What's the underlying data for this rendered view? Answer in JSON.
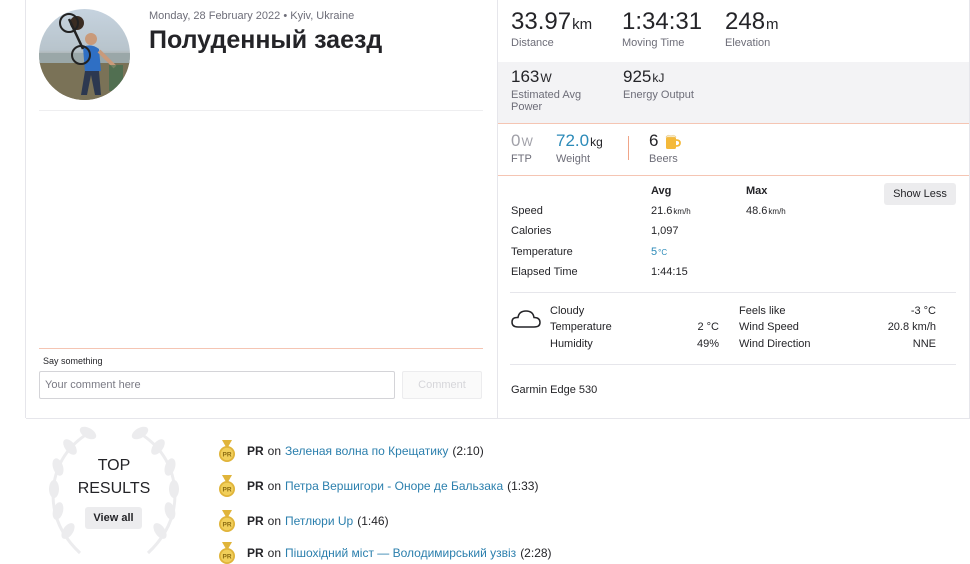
{
  "activity": {
    "meta": "Monday, 28 February 2022 • Kyiv, Ukraine",
    "title": "Полуденный заезд"
  },
  "comment": {
    "label": "Say something",
    "placeholder": "Your comment here",
    "button": "Comment"
  },
  "stats": {
    "distance": {
      "value": "33.97",
      "unit": "km",
      "label": "Distance"
    },
    "moving_time": {
      "value": "1:34:31",
      "label": "Moving Time"
    },
    "elevation": {
      "value": "248",
      "unit": "m",
      "label": "Elevation"
    },
    "power": {
      "value": "163",
      "unit": "W",
      "label_line1": "Estimated Avg",
      "label_line2": "Power"
    },
    "energy": {
      "value": "925",
      "unit": "kJ",
      "label": "Energy Output"
    },
    "ftp": {
      "value": "0",
      "unit": "W",
      "label": "FTP"
    },
    "weight": {
      "value": "72.0",
      "unit": "kg",
      "label": "Weight"
    },
    "beers": {
      "value": "6",
      "label": "Beers",
      "icon": "beer-mug-icon"
    }
  },
  "details": {
    "show_less": "Show Less",
    "col_avg": "Avg",
    "col_max": "Max",
    "rows": [
      {
        "label": "Speed",
        "avg": "21.6",
        "avg_unit": "km/h",
        "max": "48.6",
        "max_unit": "km/h"
      },
      {
        "label": "Calories",
        "avg": "1,097",
        "avg_unit": "",
        "max": "",
        "max_unit": ""
      },
      {
        "label": "Temperature",
        "avg": "5",
        "avg_unit": "°C",
        "max": "",
        "max_unit": ""
      },
      {
        "label": "Elapsed Time",
        "avg": "1:44:15",
        "avg_unit": "",
        "max": "",
        "max_unit": ""
      }
    ]
  },
  "weather": {
    "icon": "cloud-icon",
    "condition": "Cloudy",
    "temperature_label": "Temperature",
    "temperature": "2 °C",
    "humidity_label": "Humidity",
    "humidity": "49%",
    "feels_like_label": "Feels like",
    "feels_like": "-3 °C",
    "wind_speed_label": "Wind Speed",
    "wind_speed": "20.8 km/h",
    "wind_dir_label": "Wind Direction",
    "wind_dir": "NNE"
  },
  "device": "Garmin Edge 530",
  "top_results": {
    "heading_line1": "TOP",
    "heading_line2": "RESULTS",
    "view_all": "View all",
    "items": [
      {
        "badge": "PR",
        "on": "on",
        "segment": "Зеленая волна по Крещатику",
        "time": "(2:10)"
      },
      {
        "badge": "PR",
        "on": "on",
        "segment": "Петра Вершигори - Оноре де Бальзака",
        "time": "(1:33)"
      },
      {
        "badge": "PR",
        "on": "on",
        "segment": "Петлюри Up",
        "time": "(1:46)"
      },
      {
        "badge": "PR",
        "on": "on",
        "segment": "Пішохідний міст — Володимирський узвіз",
        "time": "(2:28)"
      }
    ]
  },
  "colors": {
    "accent_orange": "#fc5200",
    "link_blue": "#2b7fad",
    "medal_gold": "#e0b43a"
  }
}
